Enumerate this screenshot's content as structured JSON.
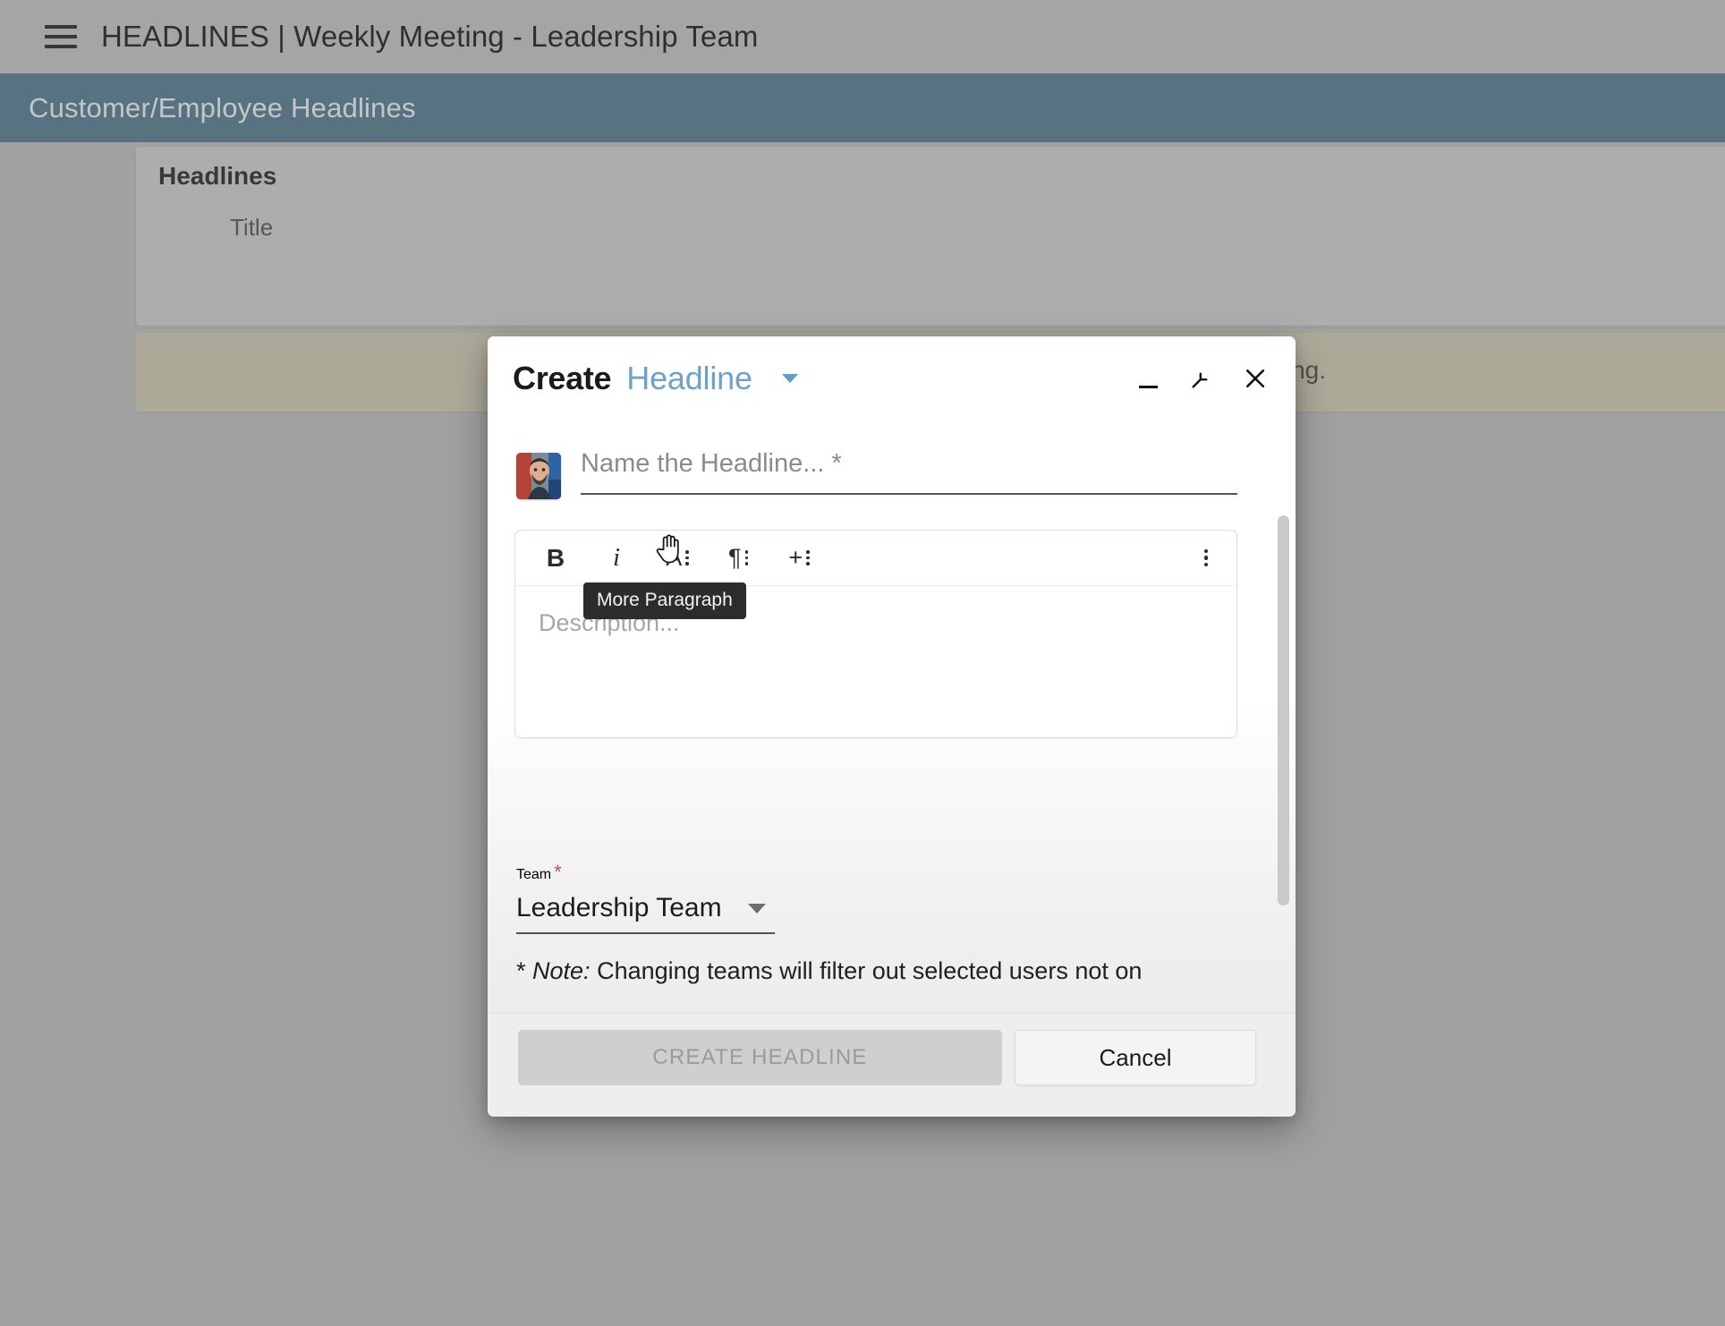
{
  "app": {
    "top_bar": {
      "menu_icon": "hamburger-menu-icon",
      "title": "HEADLINES | Weekly Meeting - Leadership Team"
    },
    "section_bar": {
      "title": "Customer/Employee Headlines"
    },
    "content_card": {
      "title": "Headlines",
      "columns": [
        "Title"
      ]
    },
    "notice_banner": {
      "text": "ing."
    }
  },
  "modal": {
    "title_prefix": "Create",
    "title_entity": "Headline",
    "entity_caret_icon": "chevron-down-icon",
    "window_controls": {
      "minimize_icon": "minimize-icon",
      "restore_icon": "collapse-diagonal-icon",
      "close_icon": "close-x-icon"
    },
    "name_field": {
      "placeholder": "Name the Headline... *",
      "value": "",
      "avatar_icon": "user-avatar-photo"
    },
    "editor": {
      "toolbar": [
        {
          "name": "bold-button",
          "glyph": "B",
          "has_dots": false
        },
        {
          "name": "italic-button",
          "glyph": "i",
          "has_dots": false
        },
        {
          "name": "more-text-button",
          "glyph": "A",
          "has_dots": true
        },
        {
          "name": "more-paragraph-button",
          "glyph": "¶",
          "has_dots": true
        },
        {
          "name": "more-rich-button",
          "glyph": "+",
          "has_dots": true
        }
      ],
      "overflow_button": "more-options-button",
      "tooltip": "More Paragraph",
      "description_placeholder": "Description...",
      "description_value": ""
    },
    "team_field": {
      "label": "Team",
      "required_marker": "*",
      "value": "Leadership Team",
      "caret_icon": "chevron-down-icon"
    },
    "note": {
      "star": "* ",
      "emphasis": "Note:",
      "text": " Changing teams will filter out selected users not on"
    },
    "footer": {
      "primary_label": "CREATE HEADLINE",
      "secondary_label": "Cancel"
    },
    "scrollbar": "vertical-scrollbar"
  },
  "colors": {
    "section_bar": "#4a7085",
    "accent_link": "#6ca2c9",
    "notice_banner": "#c6c1aa",
    "required": "#c9484b",
    "tooltip_bg": "#2c2c2c"
  }
}
